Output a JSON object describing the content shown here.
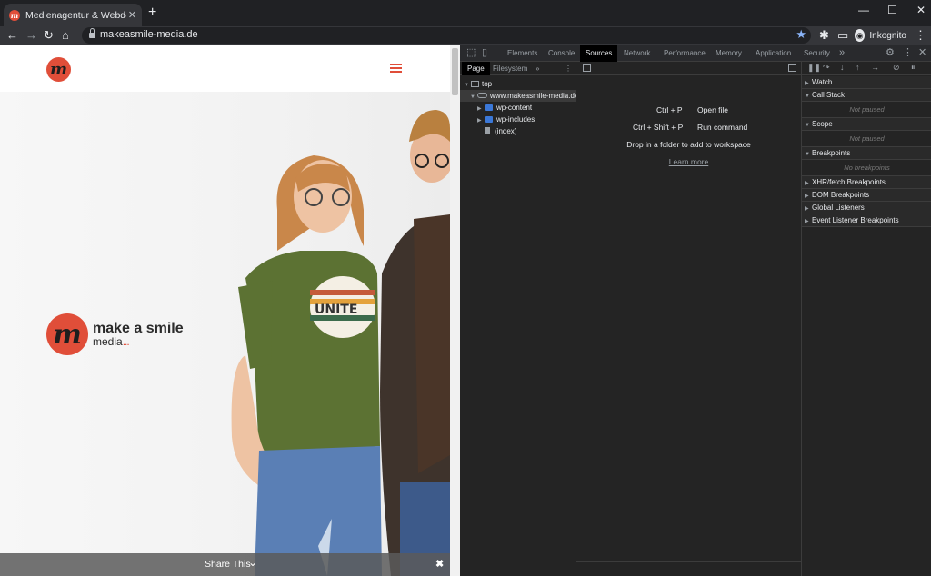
{
  "browser": {
    "tab_title": "Medienagentur & Webdesign | V",
    "tab_favicon": "m",
    "url": "makeasmile-media.de",
    "profile_label": "Inkognito",
    "icons": [
      "back-icon",
      "forward-icon",
      "reload-icon",
      "home-icon",
      "star-icon",
      "extensions-icon",
      "cast-icon",
      "menu-icon"
    ]
  },
  "site": {
    "logo_letter": "m",
    "brand_name": "make a smile",
    "brand_sub": "media",
    "brand_dots": "...",
    "share_label": "Share This",
    "colors": {
      "accent": "#e04e39"
    }
  },
  "devtools": {
    "tabs": [
      "Elements",
      "Console",
      "Sources",
      "Network",
      "Performance",
      "Memory",
      "Application",
      "Security"
    ],
    "active_tab": "Sources",
    "navigator_tabs": [
      "Page",
      "Filesystem"
    ],
    "tree": {
      "top": "top",
      "domain": "www.makeasmile-media.de",
      "folders": [
        "wp-content",
        "wp-includes"
      ],
      "file": "(index)"
    },
    "editor": {
      "shortcut1_keys": "Ctrl + P",
      "shortcut1_action": "Open file",
      "shortcut2_keys": "Ctrl + Shift + P",
      "shortcut2_action": "Run command",
      "hint": "Drop in a folder to add to workspace",
      "learn_more": "Learn more"
    },
    "debugger": {
      "watch": "Watch",
      "call_stack": "Call Stack",
      "not_paused": "Not paused",
      "scope": "Scope",
      "breakpoints": "Breakpoints",
      "no_breakpoints": "No breakpoints",
      "xhr": "XHR/fetch Breakpoints",
      "dom": "DOM Breakpoints",
      "global": "Global Listeners",
      "event": "Event Listener Breakpoints"
    }
  }
}
